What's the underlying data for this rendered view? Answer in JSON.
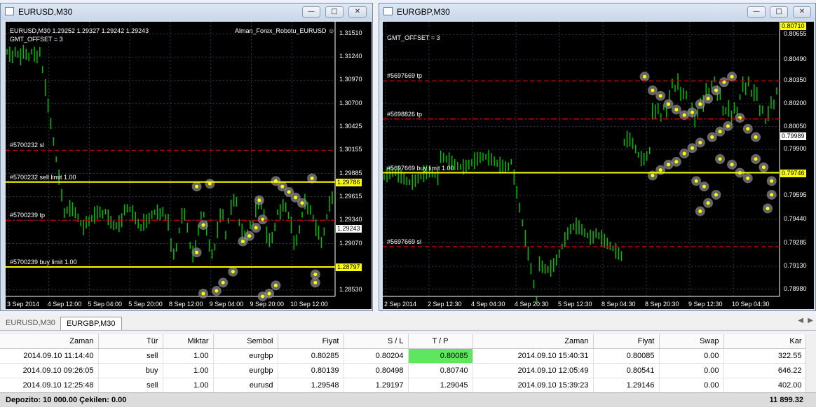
{
  "colors": {
    "chart_bg": "#000000",
    "candle": "#00c000",
    "level_yellow": "#ffff00",
    "level_red": "#c00000",
    "grid": "#2e3a4a",
    "tp_highlight": "#5ee65e"
  },
  "left_window": {
    "title": "EURUSD,M30",
    "chart_header": "EURUSD,M30  1.29252 1.29327 1.29242 1.29243",
    "ea_label": "Alman_Forex_Robotu_EURUSD",
    "gmt_offset": "GMT_OFFSET = 3",
    "y_ticks": [
      "1.31510",
      "1.31240",
      "1.30970",
      "1.30700",
      "1.30425",
      "1.30155",
      "1.29885",
      "1.29615",
      "1.29340",
      "1.29070",
      "1.28800",
      "1.28530"
    ],
    "x_ticks": [
      "3 Sep 2014",
      "4 Sep 12:00",
      "5 Sep 04:00",
      "5 Sep 20:00",
      "8 Sep 12:00",
      "9 Sep 04:00",
      "9 Sep 20:00",
      "10 Sep 12:00"
    ],
    "levels": [
      {
        "label": "#5700232 sl",
        "price": 1.30155,
        "color": "red",
        "style": "dash"
      },
      {
        "label": "#5700232 sell limit 1.00",
        "price": 1.29786,
        "color": "yellow",
        "style": "solid"
      },
      {
        "label": "#5700239 tp",
        "price": 1.2934,
        "color": "red",
        "style": "dashdot"
      },
      {
        "label": "#5700239 buy limit 1.00",
        "price": 1.28797,
        "color": "yellow",
        "style": "solid"
      }
    ],
    "price_boxes": [
      {
        "text": "1.29786",
        "price": 1.29786,
        "style": "yellow"
      },
      {
        "text": "1.29243",
        "price": 1.29243,
        "style": "white"
      },
      {
        "text": "1.28797",
        "price": 1.28797,
        "style": "yellow"
      }
    ]
  },
  "right_window": {
    "title": "EURGBP,M30",
    "chart_header": "EURGBP,M30  0.79989 0.80016 0.79974 0.79989",
    "ea_label": "Alman_Forex_Robotu_EURGBP",
    "gmt_offset": "GMT_OFFSET = 3",
    "y_ticks": [
      "0.80655",
      "0.80490",
      "0.80350",
      "0.80200",
      "0.80050",
      "0.79900",
      "0.79745",
      "0.79595",
      "0.79440",
      "0.79285",
      "0.79130",
      "0.78980"
    ],
    "x_ticks": [
      "2 Sep 2014",
      "2 Sep 12:30",
      "4 Sep 04:30",
      "4 Sep 20:30",
      "5 Sep 12:30",
      "8 Sep 04:30",
      "8 Sep 20:30",
      "9 Sep 12:30",
      "10 Sep 04:30"
    ],
    "levels": [
      {
        "label": "#5697669 tp",
        "price": 0.8035,
        "color": "red",
        "style": "dash"
      },
      {
        "label": "#5698826 tp",
        "price": 0.801,
        "color": "red",
        "style": "dashdot"
      },
      {
        "label": "#5697669 buy limit 1.00",
        "price": 0.79746,
        "color": "yellow",
        "style": "solid"
      },
      {
        "label": "#5697669 sl",
        "price": 0.7926,
        "color": "red",
        "style": "dash"
      }
    ],
    "price_boxes": [
      {
        "text": "0.80710",
        "price": 0.8071,
        "style": "yellow"
      },
      {
        "text": "0.79989",
        "price": 0.79989,
        "style": "white"
      },
      {
        "text": "0.79746",
        "price": 0.79746,
        "style": "yellow"
      }
    ]
  },
  "tabs": [
    "EURUSD,M30",
    "EURGBP,M30"
  ],
  "table": {
    "headers": [
      "Zaman",
      "Tür",
      "Miktar",
      "Sembol",
      "Fiyat",
      "S / L",
      "T / P",
      "Zaman",
      "Fiyat",
      "Swap",
      "Kar"
    ],
    "rows": [
      [
        "2014.09.10 11:14:40",
        "sell",
        "1.00",
        "eurgbp",
        "0.80285",
        "0.80204",
        "0.80085",
        "2014.09.10 15:40:31",
        "0.80085",
        "0.00",
        "322.55"
      ],
      [
        "2014.09.10 09:26:05",
        "buy",
        "1.00",
        "eurgbp",
        "0.80139",
        "0.80498",
        "0.80740",
        "2014.09.10 12:05:49",
        "0.80541",
        "0.00",
        "646.22"
      ],
      [
        "2014.09.10 12:25:48",
        "sell",
        "1.00",
        "eurusd",
        "1.29548",
        "1.29197",
        "1.29045",
        "2014.09.10 15:39:23",
        "1.29146",
        "0.00",
        "402.00"
      ]
    ]
  },
  "footer": {
    "deposit": "Depozito: 10 000.00  Çekilen: 0.00",
    "total": "11 899.32"
  }
}
